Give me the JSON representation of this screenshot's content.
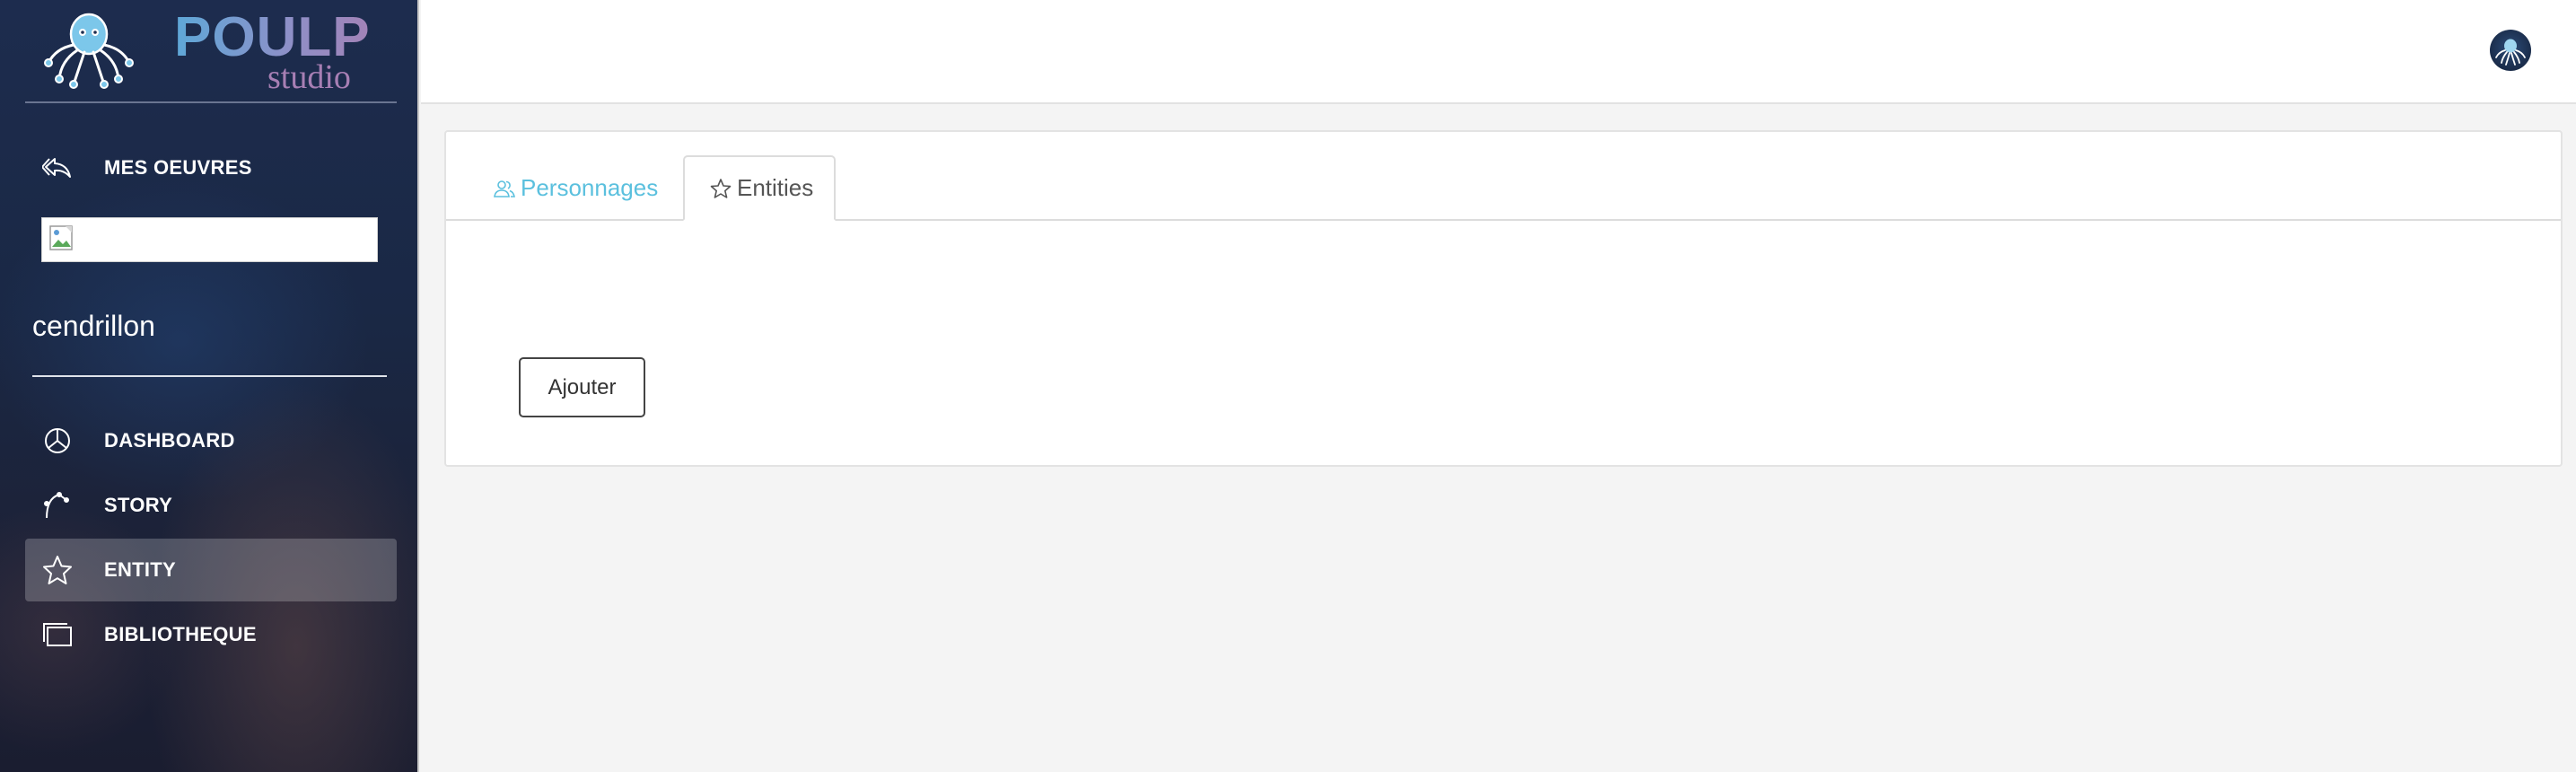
{
  "brand": {
    "name": "POULP",
    "subtitle": "studio"
  },
  "sidebar": {
    "back_item": {
      "label": "MES OEUVRES",
      "icon": "reply-arrow-icon"
    },
    "work_title": "cendrillon",
    "items": [
      {
        "label": "DASHBOARD",
        "icon": "pie-chart-icon",
        "active": false
      },
      {
        "label": "STORY",
        "icon": "bezier-curve-icon",
        "active": false
      },
      {
        "label": "ENTITY",
        "icon": "star-icon",
        "active": true
      },
      {
        "label": "BIBLIOTHEQUE",
        "icon": "gallery-icon",
        "active": false
      }
    ]
  },
  "topbar": {
    "avatar_icon": "octopus-avatar-icon"
  },
  "main": {
    "tabs": [
      {
        "label": "Personnages",
        "icon": "users-icon",
        "active": false
      },
      {
        "label": "Entities",
        "icon": "star-icon",
        "active": true
      }
    ],
    "add_button_label": "Ajouter"
  },
  "colors": {
    "sidebar_bg": "#1d2c4e",
    "tab_link": "#5bc0de",
    "active_item_bg": "rgba(255,255,255,0.22)"
  }
}
